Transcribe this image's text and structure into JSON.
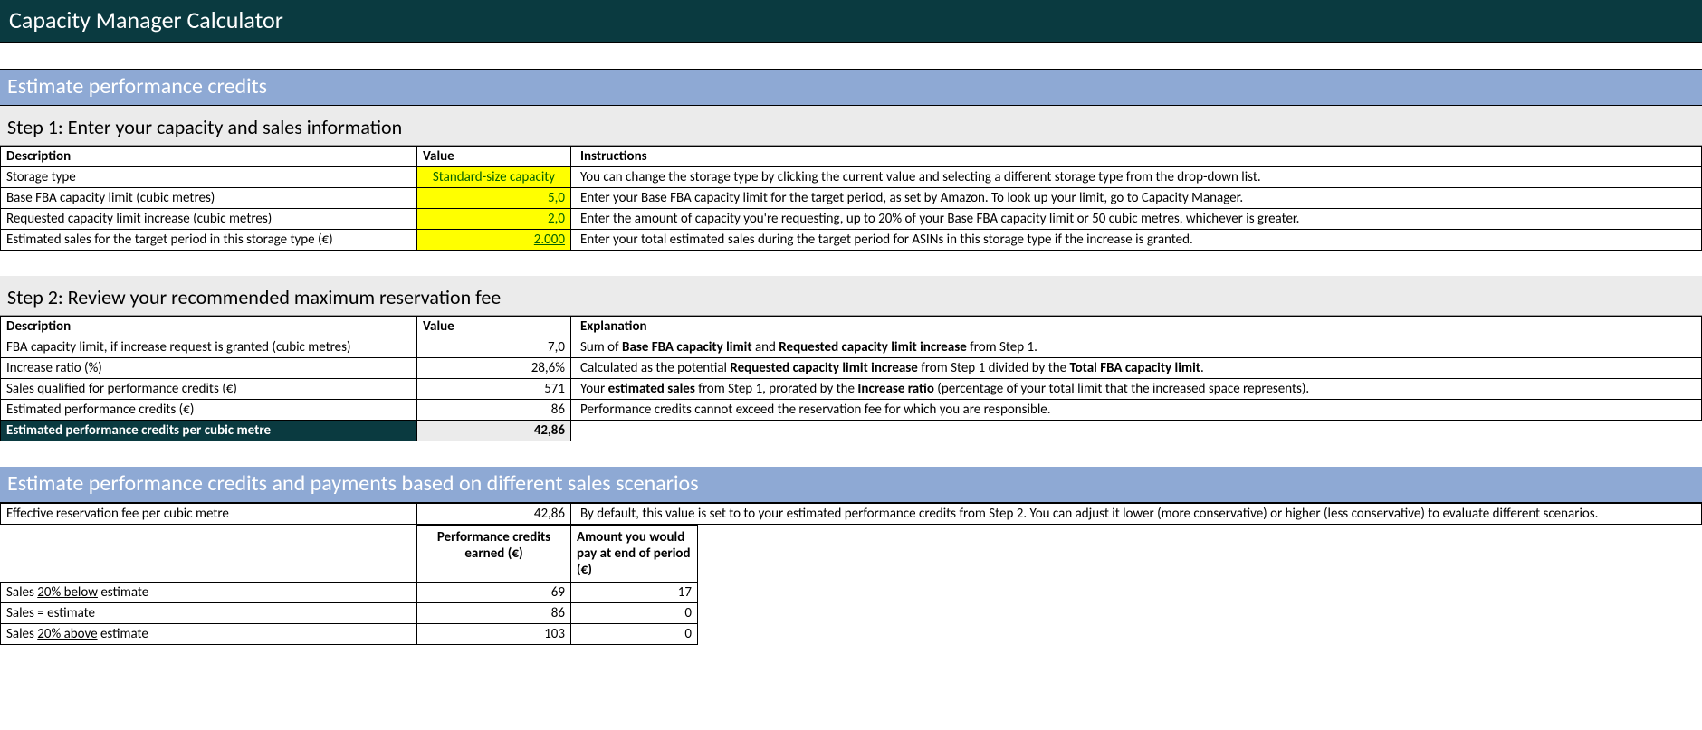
{
  "title": "Capacity Manager Calculator",
  "section1": {
    "header": "Estimate performance credits",
    "step1_title": "Step 1: Enter your capacity and sales information",
    "step1_cols": {
      "desc": "Description",
      "value": "Value",
      "instr": "Instructions"
    },
    "step1_rows": [
      {
        "desc": "Storage type",
        "value": "Standard-size capacity",
        "align": "center",
        "instr_plain": "You can change the storage type by clicking the current value and selecting a different storage type from the drop-down list."
      },
      {
        "desc": "Base FBA capacity limit (cubic metres)",
        "value": "5,0",
        "align": "right",
        "instr_plain": "Enter your Base FBA capacity limit for the target period, as set by Amazon. To look up your limit, go to Capacity Manager."
      },
      {
        "desc": "Requested capacity limit increase (cubic metres)",
        "value": "2,0",
        "align": "right",
        "instr_plain": "Enter the amount of capacity you're requesting, up to 20% of your Base FBA capacity limit or 50 cubic metres, whichever is greater."
      },
      {
        "desc": "Estimated sales for the target period in this storage type (€)",
        "value": "2.000",
        "align": "right",
        "underline": true,
        "instr_plain": "Enter your total estimated sales during the target period for ASINs in this storage type if the increase is granted."
      }
    ],
    "step2_title": "Step 2: Review your recommended maximum reservation fee",
    "step2_cols": {
      "desc": "Description",
      "value": "Value",
      "expl": "Explanation"
    },
    "step2_rows": [
      {
        "desc": "FBA capacity limit, if increase request is granted (cubic metres)",
        "value": "7,0",
        "expl_html": "Sum of <b>Base FBA capacity limit</b> and <b>Requested capacity limit increase</b> from Step 1."
      },
      {
        "desc": "Increase ratio (%)",
        "value": "28,6%",
        "expl_html": "Calculated as the potential <b>Requested capacity limit increase</b> from Step 1 divided by the <b>Total FBA capacity limit</b>."
      },
      {
        "desc": "Sales qualified for performance credits (€)",
        "value": "571",
        "expl_html": "Your <b>estimated sales</b> from Step 1, prorated by the <b>Increase ratio</b> (percentage of your total limit that the increased space represents)."
      },
      {
        "desc": "Estimated performance credits (€)",
        "value": "86",
        "expl_html": "Performance credits cannot exceed the reservation fee for which you are responsible."
      }
    ],
    "step2_summary": {
      "desc": "Estimated performance credits per cubic metre",
      "value": "42,86"
    }
  },
  "section2": {
    "header": "Estimate performance credits and payments based on different sales scenarios",
    "eff_label": "Effective reservation fee per cubic metre",
    "eff_value": "42,86",
    "eff_instr": "By default, this value is set to to your estimated performance credits from Step 2. You can adjust it lower (more conservative) or higher (less conservative) to evaluate different scenarios.",
    "cols": {
      "credits": "Performance credits earned (€)",
      "amount": "Amount you would pay at end of period (€)"
    },
    "rows": [
      {
        "label_html": "Sales <u>20% below</u> estimate",
        "credits": "69",
        "amount": "17"
      },
      {
        "label_html": "Sales = estimate",
        "credits": "86",
        "amount": "0"
      },
      {
        "label_html": "Sales <u>20% above</u> estimate",
        "credits": "103",
        "amount": "0"
      }
    ]
  }
}
